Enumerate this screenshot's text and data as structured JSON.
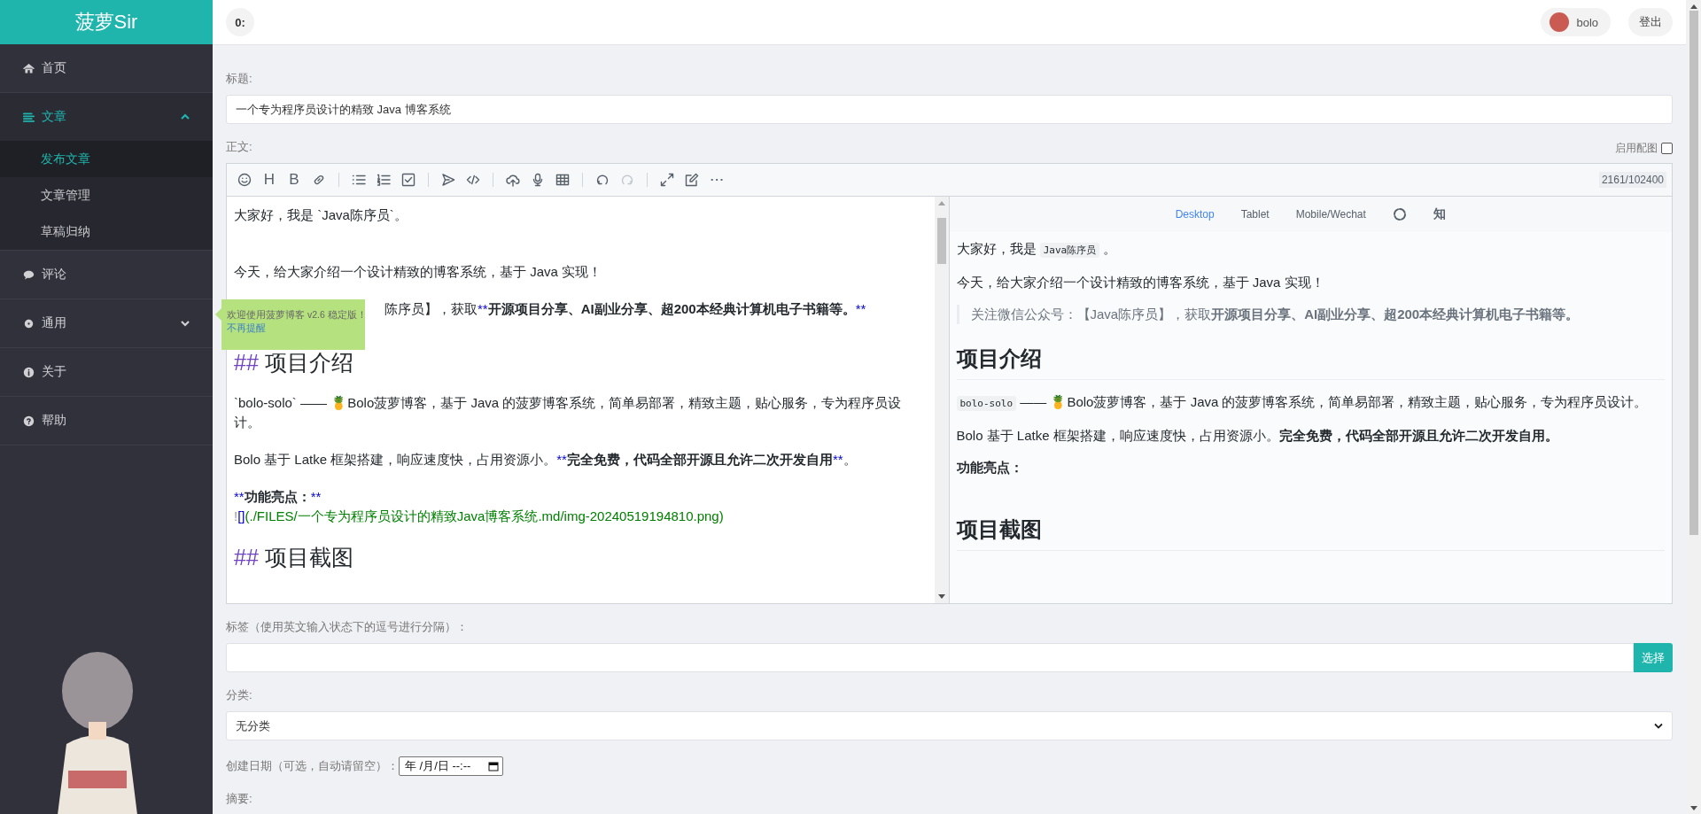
{
  "brand": "菠萝Sir",
  "sidebar": {
    "items": [
      {
        "label": "首页",
        "selected": false
      },
      {
        "label": "文章",
        "selected": true,
        "expanded": true,
        "children": [
          {
            "label": "发布文章",
            "selected": true
          },
          {
            "label": "文章管理",
            "selected": false
          },
          {
            "label": "草稿归纳",
            "selected": false
          }
        ]
      },
      {
        "label": "评论",
        "selected": false
      },
      {
        "label": "通用",
        "selected": false,
        "expanded": false
      },
      {
        "label": "关于",
        "selected": false
      },
      {
        "label": "帮助",
        "selected": false
      }
    ]
  },
  "topbar": {
    "badge": "0:",
    "user": "bolo",
    "logout": "登出"
  },
  "notice": {
    "text": "欢迎使用菠萝博客 v2.6 稳定版！",
    "link": "不再提醒"
  },
  "form": {
    "title_label": "标题:",
    "title_value": "一个专为程序员设计的精致 Java 博客系统",
    "body_label": "正文:",
    "cover_label": "启用配图",
    "cover_checked": false,
    "editor": {
      "counter": "2161/102400",
      "toolbar": [
        [
          {
            "kind": "icon",
            "disabled": false
          },
          {
            "kind": "glyph",
            "text": "H",
            "disabled": false
          },
          {
            "kind": "glyph",
            "text": "B",
            "disabled": false
          },
          {
            "kind": "icon",
            "disabled": false
          }
        ],
        [
          {
            "kind": "icon",
            "disabled": false
          },
          {
            "kind": "icon",
            "disabled": false
          },
          {
            "kind": "icon",
            "disabled": false
          }
        ],
        [
          {
            "kind": "icon",
            "disabled": false
          },
          {
            "kind": "icon",
            "disabled": false
          }
        ],
        [
          {
            "kind": "icon",
            "disabled": false
          },
          {
            "kind": "icon",
            "disabled": false
          },
          {
            "kind": "icon",
            "disabled": false
          }
        ],
        [
          {
            "kind": "icon",
            "disabled": false
          },
          {
            "kind": "icon",
            "disabled": true
          }
        ],
        [
          {
            "kind": "icon",
            "disabled": false
          },
          {
            "kind": "icon",
            "disabled": false
          },
          {
            "kind": "icon",
            "disabled": false
          }
        ]
      ],
      "lines": [
        {
          "kind": "text",
          "segments": [
            {
              "kind": "plain",
              "text": "大家好，我是 `Java陈序员`。"
            }
          ]
        },
        {
          "kind": "blank"
        },
        {
          "kind": "text",
          "segments": [
            {
              "kind": "plain",
              "text": "今天，给大家介绍一个设计精致的博客系统，基于 Java 实现！"
            }
          ]
        },
        {
          "kind": "covered",
          "segments": [
            {
              "kind": "plain",
              "text": "陈序员】，获取"
            },
            {
              "kind": "syntax",
              "text": "**"
            },
            {
              "kind": "bold",
              "text": "开源项目分享、AI副业分享、超200本经典计算机电子书籍等。"
            },
            {
              "kind": "syntax",
              "text": "**"
            }
          ]
        },
        {
          "kind": "heading",
          "segments": [
            {
              "kind": "hash",
              "text": "## "
            },
            {
              "kind": "plain",
              "text": "项目介绍"
            }
          ]
        },
        {
          "kind": "text",
          "segments": [
            {
              "kind": "plain",
              "text": "`bolo-solo` —— 🍍Bolo菠萝博客，基于 Java 的菠萝博客系统，简单易部署，精致主题，贴心服务，专为程序员设计。"
            }
          ]
        },
        {
          "kind": "text",
          "segments": [
            {
              "kind": "plain",
              "text": "Bolo 基于 Latke 框架搭建，响应速度快，占用资源小。"
            },
            {
              "kind": "syntax",
              "text": "**"
            },
            {
              "kind": "bold",
              "text": "完全免费，代码全部开源且允许二次开发自用"
            },
            {
              "kind": "syntax",
              "text": "**"
            },
            {
              "kind": "plain",
              "text": "。"
            }
          ]
        },
        {
          "kind": "tight",
          "segments": [
            {
              "kind": "syntax",
              "text": "**"
            },
            {
              "kind": "bold",
              "text": "功能亮点："
            },
            {
              "kind": "syntax",
              "text": "**"
            }
          ]
        },
        {
          "kind": "text",
          "segments": [
            {
              "kind": "bang",
              "text": "!"
            },
            {
              "kind": "syntax",
              "text": "[]"
            },
            {
              "kind": "link",
              "text": "(./FILES/一个专为程序员设计的精致Java博客系统.md/img-20240519194810.png)"
            }
          ]
        },
        {
          "kind": "heading",
          "segments": [
            {
              "kind": "hash",
              "text": "## "
            },
            {
              "kind": "plain",
              "text": "项目截图"
            }
          ]
        }
      ]
    },
    "preview": {
      "tabs": [
        {
          "kind": "text",
          "label": "Desktop",
          "selected": true
        },
        {
          "kind": "text",
          "label": "Tablet",
          "selected": false
        },
        {
          "kind": "text",
          "label": "Mobile/Wechat",
          "selected": false
        },
        {
          "kind": "icon",
          "selected": false
        },
        {
          "kind": "text",
          "label": "知",
          "selected": false
        }
      ],
      "blocks": [
        {
          "kind": "p",
          "segments": [
            {
              "kind": "plain",
              "text": "大家好，我是 "
            },
            {
              "kind": "code",
              "text": "Java陈序员"
            },
            {
              "kind": "plain",
              "text": " 。"
            }
          ]
        },
        {
          "kind": "p",
          "segments": [
            {
              "kind": "plain",
              "text": "今天，给大家介绍一个设计精致的博客系统，基于 Java 实现！"
            }
          ]
        },
        {
          "kind": "quote",
          "segments": [
            {
              "kind": "plain",
              "text": "关注微信公众号：【Java陈序员】，获取"
            },
            {
              "kind": "bold",
              "text": "开源项目分享、AI副业分享、超200本经典计算机电子书籍等。"
            }
          ]
        },
        {
          "kind": "h2",
          "segments": [
            {
              "kind": "plain",
              "text": "项目介绍"
            }
          ]
        },
        {
          "kind": "p",
          "segments": [
            {
              "kind": "code",
              "text": "bolo-solo"
            },
            {
              "kind": "plain",
              "text": " —— 🍍Bolo菠萝博客，基于 Java 的菠萝博客系统，简单易部署，精致主题，贴心服务，专为程序员设计。"
            }
          ]
        },
        {
          "kind": "p",
          "segments": [
            {
              "kind": "plain",
              "text": "Bolo 基于 Latke 框架搭建，响应速度快，占用资源小。"
            },
            {
              "kind": "bold",
              "text": "完全免费，代码全部开源且允许二次开发自用。"
            }
          ]
        },
        {
          "kind": "p",
          "segments": [
            {
              "kind": "bold",
              "text": "功能亮点："
            }
          ]
        },
        {
          "kind": "h2",
          "segments": [
            {
              "kind": "plain",
              "text": "项目截图"
            }
          ]
        }
      ]
    },
    "tags_label": "标签（使用英文输入状态下的逗号进行分隔）：",
    "tags_button": "选择",
    "category_label": "分类:",
    "category_value": "无分类",
    "date_label": "创建日期（可选，自动请留空）：",
    "date_value": "年 /月/日 --:--",
    "summary_label": "摘要:"
  }
}
